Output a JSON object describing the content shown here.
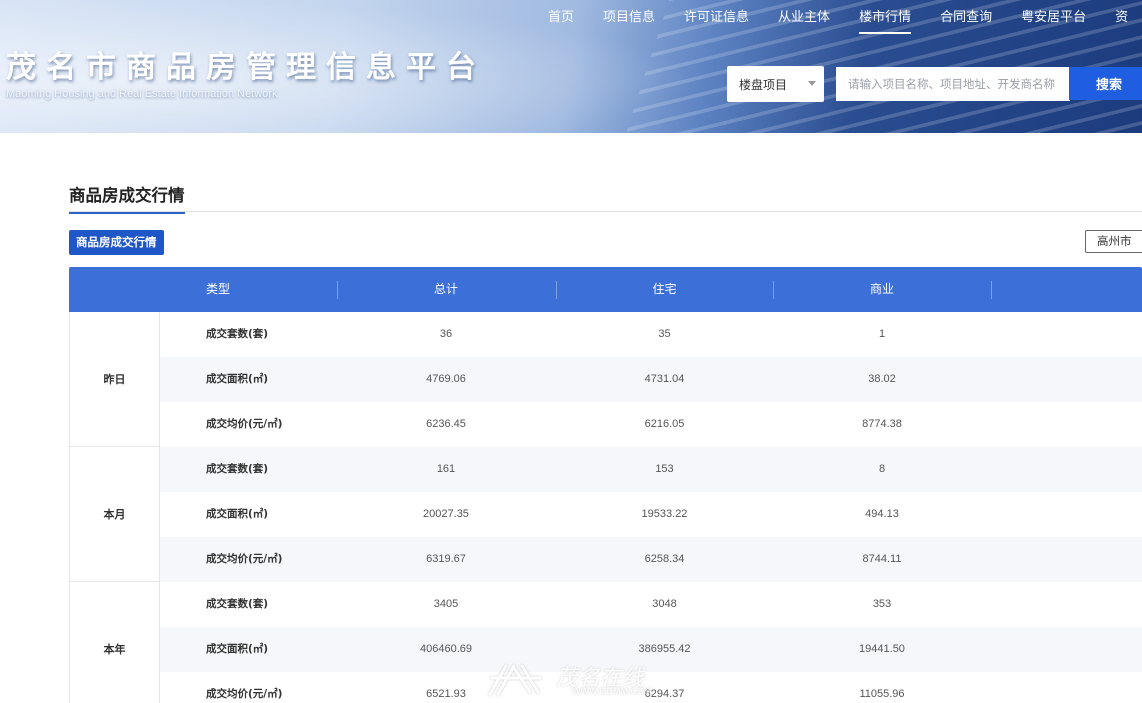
{
  "header": {
    "site_title": "茂名市商品房管理信息平台",
    "site_subtitle": "Maoming Housing and Real Estate Information Network",
    "nav": [
      {
        "label": "首页"
      },
      {
        "label": "项目信息"
      },
      {
        "label": "许可证信息"
      },
      {
        "label": "从业主体"
      },
      {
        "label": "楼市行情",
        "active": true
      },
      {
        "label": "合同查询"
      },
      {
        "label": "粤安居平台"
      },
      {
        "label": "资"
      }
    ],
    "search": {
      "category_value": "楼盘项目",
      "placeholder": "请输入项目名称、项目地址、开发商名称",
      "button_label": "搜索"
    }
  },
  "section": {
    "title": "商品房成交行情",
    "tab_label": "商品房成交行情",
    "city_value": "高州市"
  },
  "table": {
    "headers": [
      "类型",
      "总计",
      "住宅",
      "商业"
    ],
    "groups": [
      {
        "label": "昨日",
        "rows": [
          {
            "metric": "成交套数(套)",
            "total": "36",
            "residential": "35",
            "commercial": "1"
          },
          {
            "metric": "成交面积(㎡)",
            "total": "4769.06",
            "residential": "4731.04",
            "commercial": "38.02"
          },
          {
            "metric": "成交均价(元/㎡)",
            "total": "6236.45",
            "residential": "6216.05",
            "commercial": "8774.38"
          }
        ]
      },
      {
        "label": "本月",
        "rows": [
          {
            "metric": "成交套数(套)",
            "total": "161",
            "residential": "153",
            "commercial": "8"
          },
          {
            "metric": "成交面积(㎡)",
            "total": "20027.35",
            "residential": "19533.22",
            "commercial": "494.13"
          },
          {
            "metric": "成交均价(元/㎡)",
            "total": "6319.67",
            "residential": "6258.34",
            "commercial": "8744.11"
          }
        ]
      },
      {
        "label": "本年",
        "rows": [
          {
            "metric": "成交套数(套)",
            "total": "3405",
            "residential": "3048",
            "commercial": "353"
          },
          {
            "metric": "成交面积(㎡)",
            "total": "406460.69",
            "residential": "386955.42",
            "commercial": "19441.50"
          },
          {
            "metric": "成交均价(元/㎡)",
            "total": "6521.93",
            "residential": "6294.37",
            "commercial": "11055.96"
          }
        ]
      }
    ]
  },
  "watermark": {
    "text": "茂名在线",
    "url": "WWW.GDMM.COM"
  }
}
